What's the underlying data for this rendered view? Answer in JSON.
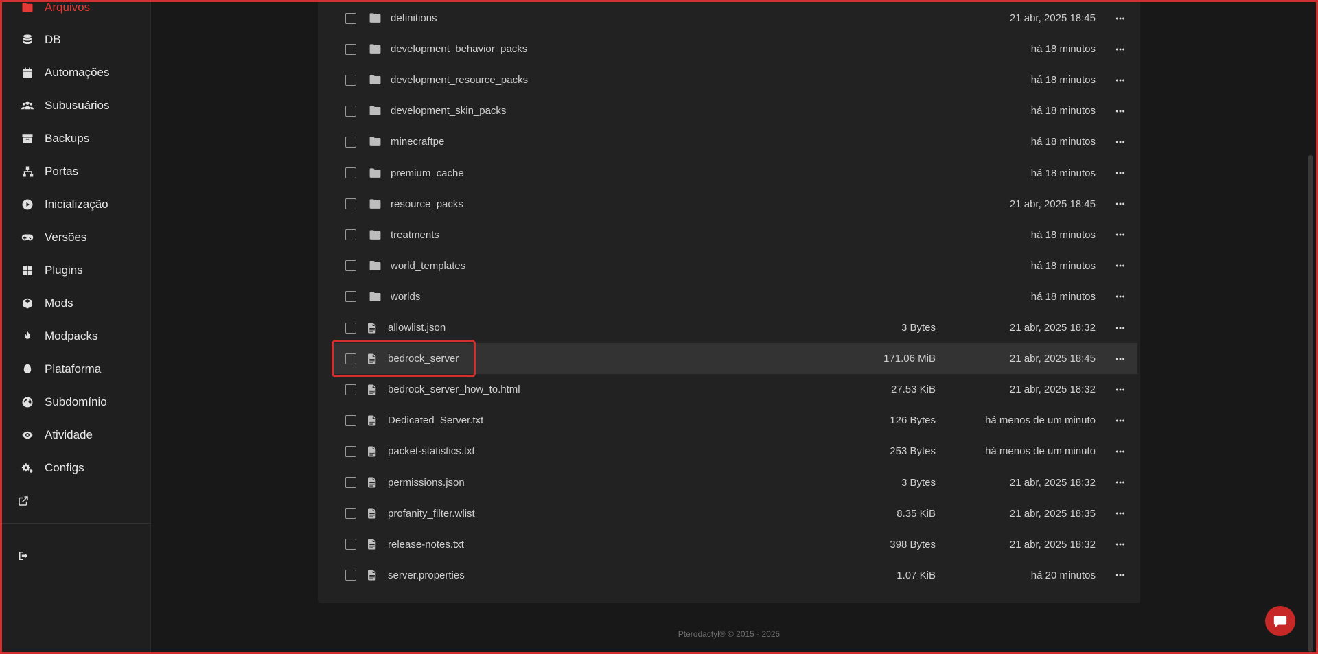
{
  "sidebar": {
    "items": [
      {
        "label": "Arquivos",
        "icon": "folder-icon",
        "active": true
      },
      {
        "label": "DB",
        "icon": "database-icon"
      },
      {
        "label": "Automações",
        "icon": "calendar-icon"
      },
      {
        "label": "Subusuários",
        "icon": "users-icon"
      },
      {
        "label": "Backups",
        "icon": "archive-icon"
      },
      {
        "label": "Portas",
        "icon": "network-icon"
      },
      {
        "label": "Inicialização",
        "icon": "play-circle-icon"
      },
      {
        "label": "Versões",
        "icon": "gamepad-icon"
      },
      {
        "label": "Plugins",
        "icon": "grid-icon"
      },
      {
        "label": "Mods",
        "icon": "cube-icon"
      },
      {
        "label": "Modpacks",
        "icon": "flame-icon"
      },
      {
        "label": "Plataforma",
        "icon": "egg-icon"
      },
      {
        "label": "Subdomínio",
        "icon": "globe-icon"
      },
      {
        "label": "Atividade",
        "icon": "eye-icon"
      },
      {
        "label": "Configs",
        "icon": "cogs-icon"
      }
    ],
    "external_link_icon": "external-link-icon",
    "logout_icon": "logout-icon"
  },
  "files": [
    {
      "name": "definitions",
      "type": "folder",
      "size": "",
      "modified": "21 abr, 2025 18:45"
    },
    {
      "name": "development_behavior_packs",
      "type": "folder",
      "size": "",
      "modified": "há 18 minutos"
    },
    {
      "name": "development_resource_packs",
      "type": "folder",
      "size": "",
      "modified": "há 18 minutos"
    },
    {
      "name": "development_skin_packs",
      "type": "folder",
      "size": "",
      "modified": "há 18 minutos"
    },
    {
      "name": "minecraftpe",
      "type": "folder",
      "size": "",
      "modified": "há 18 minutos"
    },
    {
      "name": "premium_cache",
      "type": "folder",
      "size": "",
      "modified": "há 18 minutos"
    },
    {
      "name": "resource_packs",
      "type": "folder",
      "size": "",
      "modified": "21 abr, 2025 18:45"
    },
    {
      "name": "treatments",
      "type": "folder",
      "size": "",
      "modified": "há 18 minutos"
    },
    {
      "name": "world_templates",
      "type": "folder",
      "size": "",
      "modified": "há 18 minutos"
    },
    {
      "name": "worlds",
      "type": "folder",
      "size": "",
      "modified": "há 18 minutos"
    },
    {
      "name": "allowlist.json",
      "type": "file",
      "size": "3 Bytes",
      "modified": "21 abr, 2025 18:32"
    },
    {
      "name": "bedrock_server",
      "type": "file",
      "size": "171.06 MiB",
      "modified": "21 abr, 2025 18:45",
      "highlighted": true
    },
    {
      "name": "bedrock_server_how_to.html",
      "type": "file",
      "size": "27.53 KiB",
      "modified": "21 abr, 2025 18:32"
    },
    {
      "name": "Dedicated_Server.txt",
      "type": "file",
      "size": "126 Bytes",
      "modified": "há menos de um minuto"
    },
    {
      "name": "packet-statistics.txt",
      "type": "file",
      "size": "253 Bytes",
      "modified": "há menos de um minuto"
    },
    {
      "name": "permissions.json",
      "type": "file",
      "size": "3 Bytes",
      "modified": "21 abr, 2025 18:32"
    },
    {
      "name": "profanity_filter.wlist",
      "type": "file",
      "size": "8.35 KiB",
      "modified": "21 abr, 2025 18:35"
    },
    {
      "name": "release-notes.txt",
      "type": "file",
      "size": "398 Bytes",
      "modified": "21 abr, 2025 18:32"
    },
    {
      "name": "server.properties",
      "type": "file",
      "size": "1.07 KiB",
      "modified": "há 20 minutos"
    }
  ],
  "footer": {
    "text": "Pterodactyl® © 2015 - 2025"
  },
  "colors": {
    "accent": "#e53935",
    "background": "#181818",
    "panel": "#222222",
    "sidebar": "#1f1f1f"
  }
}
